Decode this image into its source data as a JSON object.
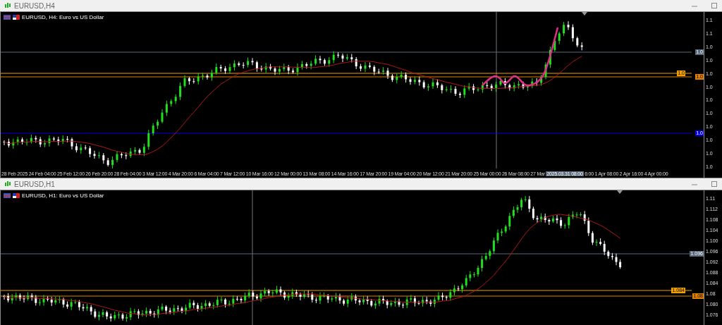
{
  "windows": [
    {
      "title": "EURUSD,H4",
      "legend": "EURUSD, H4: Euro vs US Dollar",
      "price_labels": [
        "1.1",
        "1.1",
        "1.0",
        "1.0",
        "1.0",
        "1.0",
        "1.0",
        "1.0",
        "1.0",
        "1.0",
        "1.0",
        "1.0"
      ],
      "price_tags": [
        {
          "label": "1.0",
          "color": "#5a6a7a"
        },
        {
          "label": "1.0",
          "color": "#f0a000"
        },
        {
          "label": "1.0",
          "color": "#e08000"
        },
        {
          "label": "1.0",
          "color": "#0000e0"
        }
      ],
      "x_labels": [
        {
          "text": "28 Feb 2025",
          "kind": "tick"
        },
        {
          "text": "24 Feb 04:00",
          "kind": "tick"
        },
        {
          "text": "25 Feb 12:00",
          "kind": "tick"
        },
        {
          "text": "26 Feb 20:00",
          "kind": "tick"
        },
        {
          "text": "28 Feb 04:00",
          "kind": "tick"
        },
        {
          "text": "3 Mar 12:00",
          "kind": "tick"
        },
        {
          "text": "4 Mar 20:00",
          "kind": "tick"
        },
        {
          "text": "6 Mar 04:00",
          "kind": "tick"
        },
        {
          "text": "7 Mar 12:00",
          "kind": "tick"
        },
        {
          "text": "10 Mar 16:00",
          "kind": "tick"
        },
        {
          "text": "12 Mar 00:00",
          "kind": "tick"
        },
        {
          "text": "13 Mar 08:00",
          "kind": "tick"
        },
        {
          "text": "14 Mar 16:00",
          "kind": "tick"
        },
        {
          "text": "17 Mar 20:00",
          "kind": "tick"
        },
        {
          "text": "19 Mar 04:00",
          "kind": "tick"
        },
        {
          "text": "20 Mar 12:00",
          "kind": "tick"
        },
        {
          "text": "21 Mar 20:00",
          "kind": "tick"
        },
        {
          "text": "25 Mar 00:00",
          "kind": "tick"
        },
        {
          "text": "26 Mar 08:00",
          "kind": "tick"
        },
        {
          "text": "27 Mar",
          "kind": "tick"
        },
        {
          "text": "2025.03.31 08:00",
          "kind": "cursor"
        },
        {
          "text": "6:00",
          "kind": "tick"
        },
        {
          "text": "1 Apr 08:00",
          "kind": "tick"
        },
        {
          "text": "2 Apr 16:00",
          "kind": "tick"
        },
        {
          "text": "4 Apr 00:00",
          "kind": "tick"
        }
      ]
    },
    {
      "title": "EURUSD,H1",
      "legend": "EURUSD, H1: Euro vs US Dollar",
      "price_labels": [
        "1.11",
        "1.112",
        "1.108",
        "1.104",
        "1.100",
        "1.096",
        "1.092",
        "1.088",
        "1.084",
        "1.08",
        "1.080",
        "1.076"
      ],
      "price_tags": [
        {
          "label": "1.096",
          "color": "#5a6a7a"
        },
        {
          "label": "1.084",
          "color": "#f0a000"
        },
        {
          "label": "1.08",
          "color": "#e08000"
        }
      ]
    }
  ]
}
